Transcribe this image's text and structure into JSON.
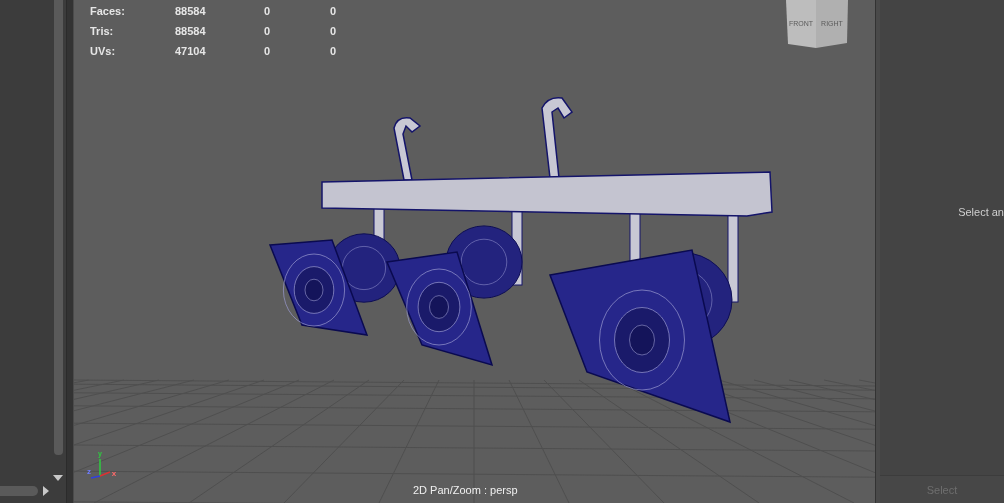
{
  "hud": {
    "rows": [
      {
        "label": "Faces:",
        "values": [
          "88584",
          "0",
          "0"
        ]
      },
      {
        "label": "Tris:",
        "values": [
          "88584",
          "0",
          "0"
        ]
      },
      {
        "label": "UVs:",
        "values": [
          "47104",
          "0",
          "0"
        ]
      }
    ]
  },
  "view_cube": {
    "faces": [
      "FRONT",
      "RIGHT"
    ]
  },
  "axis_gizmo": {
    "y_label": "y",
    "z_label": "z",
    "x_label": "x"
  },
  "viewport_label": "2D Pan/Zoom : persp",
  "side_panel": {
    "message": "Select an",
    "button": {
      "label": "Select",
      "disabled": true
    }
  }
}
